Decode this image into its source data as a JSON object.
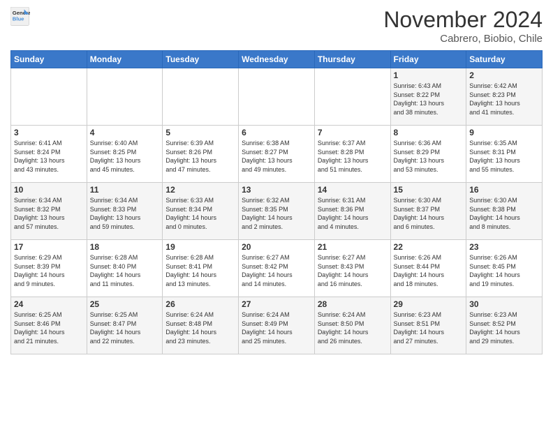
{
  "logo": {
    "line1": "General",
    "line2": "Blue"
  },
  "title": "November 2024",
  "subtitle": "Cabrero, Biobio, Chile",
  "days_of_week": [
    "Sunday",
    "Monday",
    "Tuesday",
    "Wednesday",
    "Thursday",
    "Friday",
    "Saturday"
  ],
  "weeks": [
    [
      {
        "day": "",
        "info": ""
      },
      {
        "day": "",
        "info": ""
      },
      {
        "day": "",
        "info": ""
      },
      {
        "day": "",
        "info": ""
      },
      {
        "day": "",
        "info": ""
      },
      {
        "day": "1",
        "info": "Sunrise: 6:43 AM\nSunset: 8:22 PM\nDaylight: 13 hours\nand 38 minutes."
      },
      {
        "day": "2",
        "info": "Sunrise: 6:42 AM\nSunset: 8:23 PM\nDaylight: 13 hours\nand 41 minutes."
      }
    ],
    [
      {
        "day": "3",
        "info": "Sunrise: 6:41 AM\nSunset: 8:24 PM\nDaylight: 13 hours\nand 43 minutes."
      },
      {
        "day": "4",
        "info": "Sunrise: 6:40 AM\nSunset: 8:25 PM\nDaylight: 13 hours\nand 45 minutes."
      },
      {
        "day": "5",
        "info": "Sunrise: 6:39 AM\nSunset: 8:26 PM\nDaylight: 13 hours\nand 47 minutes."
      },
      {
        "day": "6",
        "info": "Sunrise: 6:38 AM\nSunset: 8:27 PM\nDaylight: 13 hours\nand 49 minutes."
      },
      {
        "day": "7",
        "info": "Sunrise: 6:37 AM\nSunset: 8:28 PM\nDaylight: 13 hours\nand 51 minutes."
      },
      {
        "day": "8",
        "info": "Sunrise: 6:36 AM\nSunset: 8:29 PM\nDaylight: 13 hours\nand 53 minutes."
      },
      {
        "day": "9",
        "info": "Sunrise: 6:35 AM\nSunset: 8:31 PM\nDaylight: 13 hours\nand 55 minutes."
      }
    ],
    [
      {
        "day": "10",
        "info": "Sunrise: 6:34 AM\nSunset: 8:32 PM\nDaylight: 13 hours\nand 57 minutes."
      },
      {
        "day": "11",
        "info": "Sunrise: 6:34 AM\nSunset: 8:33 PM\nDaylight: 13 hours\nand 59 minutes."
      },
      {
        "day": "12",
        "info": "Sunrise: 6:33 AM\nSunset: 8:34 PM\nDaylight: 14 hours\nand 0 minutes."
      },
      {
        "day": "13",
        "info": "Sunrise: 6:32 AM\nSunset: 8:35 PM\nDaylight: 14 hours\nand 2 minutes."
      },
      {
        "day": "14",
        "info": "Sunrise: 6:31 AM\nSunset: 8:36 PM\nDaylight: 14 hours\nand 4 minutes."
      },
      {
        "day": "15",
        "info": "Sunrise: 6:30 AM\nSunset: 8:37 PM\nDaylight: 14 hours\nand 6 minutes."
      },
      {
        "day": "16",
        "info": "Sunrise: 6:30 AM\nSunset: 8:38 PM\nDaylight: 14 hours\nand 8 minutes."
      }
    ],
    [
      {
        "day": "17",
        "info": "Sunrise: 6:29 AM\nSunset: 8:39 PM\nDaylight: 14 hours\nand 9 minutes."
      },
      {
        "day": "18",
        "info": "Sunrise: 6:28 AM\nSunset: 8:40 PM\nDaylight: 14 hours\nand 11 minutes."
      },
      {
        "day": "19",
        "info": "Sunrise: 6:28 AM\nSunset: 8:41 PM\nDaylight: 14 hours\nand 13 minutes."
      },
      {
        "day": "20",
        "info": "Sunrise: 6:27 AM\nSunset: 8:42 PM\nDaylight: 14 hours\nand 14 minutes."
      },
      {
        "day": "21",
        "info": "Sunrise: 6:27 AM\nSunset: 8:43 PM\nDaylight: 14 hours\nand 16 minutes."
      },
      {
        "day": "22",
        "info": "Sunrise: 6:26 AM\nSunset: 8:44 PM\nDaylight: 14 hours\nand 18 minutes."
      },
      {
        "day": "23",
        "info": "Sunrise: 6:26 AM\nSunset: 8:45 PM\nDaylight: 14 hours\nand 19 minutes."
      }
    ],
    [
      {
        "day": "24",
        "info": "Sunrise: 6:25 AM\nSunset: 8:46 PM\nDaylight: 14 hours\nand 21 minutes."
      },
      {
        "day": "25",
        "info": "Sunrise: 6:25 AM\nSunset: 8:47 PM\nDaylight: 14 hours\nand 22 minutes."
      },
      {
        "day": "26",
        "info": "Sunrise: 6:24 AM\nSunset: 8:48 PM\nDaylight: 14 hours\nand 23 minutes."
      },
      {
        "day": "27",
        "info": "Sunrise: 6:24 AM\nSunset: 8:49 PM\nDaylight: 14 hours\nand 25 minutes."
      },
      {
        "day": "28",
        "info": "Sunrise: 6:24 AM\nSunset: 8:50 PM\nDaylight: 14 hours\nand 26 minutes."
      },
      {
        "day": "29",
        "info": "Sunrise: 6:23 AM\nSunset: 8:51 PM\nDaylight: 14 hours\nand 27 minutes."
      },
      {
        "day": "30",
        "info": "Sunrise: 6:23 AM\nSunset: 8:52 PM\nDaylight: 14 hours\nand 29 minutes."
      }
    ]
  ]
}
